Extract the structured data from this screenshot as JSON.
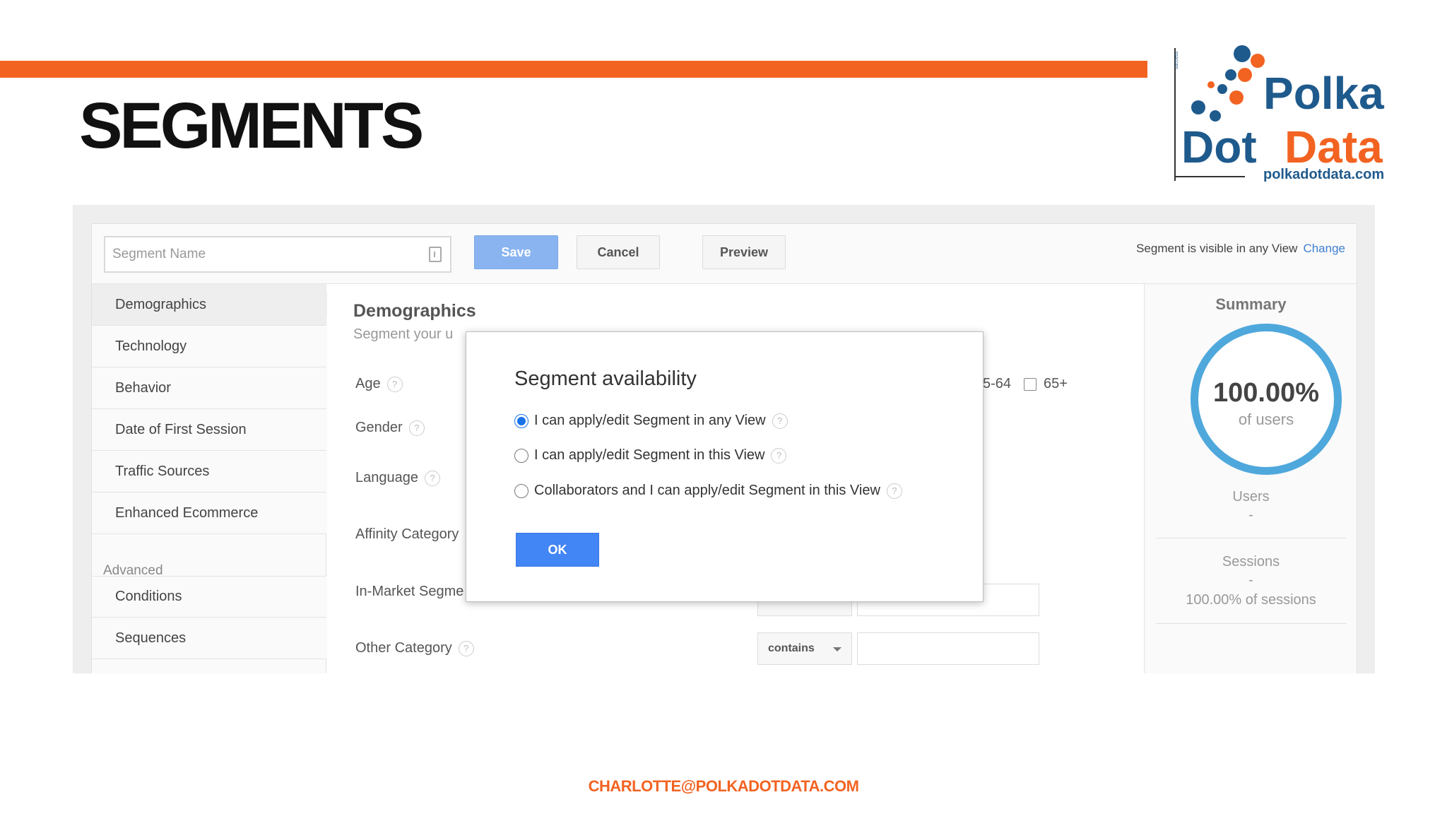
{
  "slide": {
    "title": "SEGMENTS",
    "footer_email": "CHARLOTTE@POLKADOTDATA.COM"
  },
  "logo": {
    "line1": "Polka",
    "line2_a": "Dot",
    "line2_b": "Data",
    "url": "polkadotdata.com",
    "tag": "success",
    "colors": {
      "blue": "#1f5a8c",
      "orange": "#f26322"
    }
  },
  "toolbar": {
    "segment_name_placeholder": "Segment Name",
    "save_label": "Save",
    "cancel_label": "Cancel",
    "preview_label": "Preview",
    "visibility_text": "Segment is visible in any View",
    "change_label": "Change"
  },
  "sidebar": {
    "items": [
      {
        "label": "Demographics"
      },
      {
        "label": "Technology"
      },
      {
        "label": "Behavior"
      },
      {
        "label": "Date of First Session"
      },
      {
        "label": "Traffic Sources"
      },
      {
        "label": "Enhanced Ecommerce"
      }
    ],
    "advanced_header": "Advanced",
    "advanced_items": [
      {
        "label": "Conditions"
      },
      {
        "label": "Sequences"
      }
    ]
  },
  "main": {
    "title": "Demographics",
    "subtitle": "Segment your u",
    "fields": {
      "age": "Age",
      "gender": "Gender",
      "language": "Language",
      "affinity": "Affinity Category",
      "in_market": "In-Market Segme",
      "other": "Other Category"
    },
    "age_tail_a": "5-64",
    "age_tail_b": "65+",
    "other_select": "contains"
  },
  "summary": {
    "title": "Summary",
    "percent": "100.00%",
    "percent_label": "of users",
    "users_label": "Users",
    "users_value": "-",
    "sessions_label": "Sessions",
    "sessions_value": "-",
    "sessions_pct": "100.00% of sessions"
  },
  "modal": {
    "title": "Segment availability",
    "options": [
      {
        "label": "I can apply/edit Segment in any View",
        "selected": true
      },
      {
        "label": "I can apply/edit Segment in this View",
        "selected": false
      },
      {
        "label": "Collaborators and I can apply/edit Segment in this View",
        "selected": false
      }
    ],
    "ok_label": "OK"
  }
}
